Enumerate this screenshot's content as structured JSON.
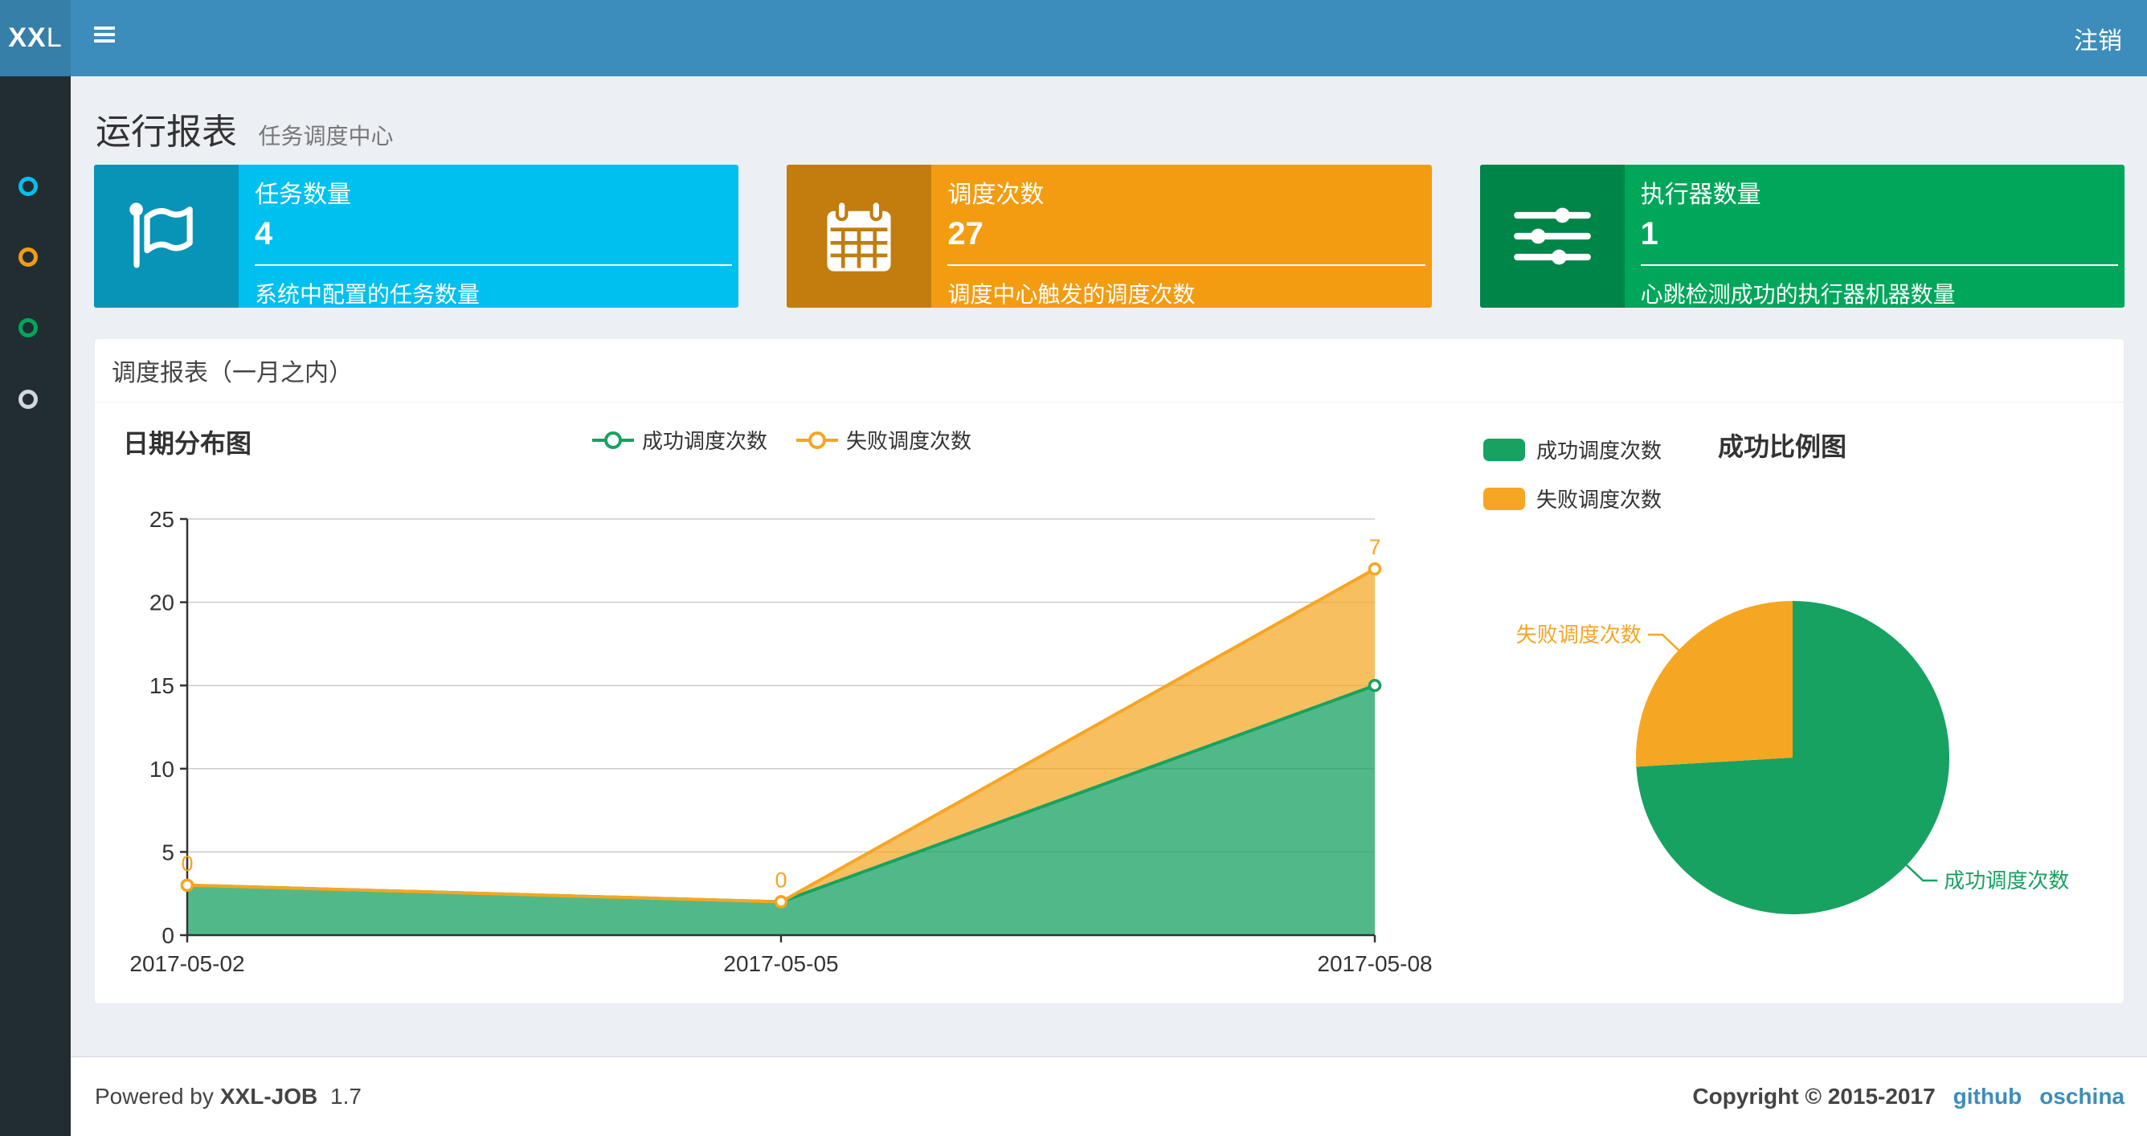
{
  "topbar": {
    "logo_bold": "XX",
    "logo_light": "L",
    "logout_label": "注销",
    "bar_color": "#3c8dbc",
    "logo_bg": "#367fa9"
  },
  "sidebar": {
    "bg": "#222d32",
    "items": [
      {
        "icon": "circle-icon",
        "color": "#00c0ef"
      },
      {
        "icon": "circle-icon",
        "color": "#f39c12"
      },
      {
        "icon": "circle-icon",
        "color": "#00a65a"
      },
      {
        "icon": "circle-icon",
        "color": "#d2d6de"
      }
    ]
  },
  "page": {
    "title": "运行报表",
    "subtitle": "任务调度中心"
  },
  "cards": [
    {
      "label": "任务数量",
      "value": "4",
      "desc": "系统中配置的任务数量",
      "color": "#00c0ef",
      "icon_bg": "#0894b6",
      "icon": "flag-icon"
    },
    {
      "label": "调度次数",
      "value": "27",
      "desc": "调度中心触发的调度次数",
      "color": "#f39c12",
      "icon_bg": "#c27d0e",
      "icon": "calendar-icon"
    },
    {
      "label": "执行器数量",
      "value": "1",
      "desc": "心跳检测成功的执行器机器数量",
      "color": "#00a65a",
      "icon_bg": "#008548",
      "icon": "sliders-icon"
    }
  ],
  "panel": {
    "title": "调度报表（一月之内）"
  },
  "chart_data": [
    {
      "type": "area",
      "title": "日期分布图",
      "x": [
        "2017-05-02",
        "2017-05-05",
        "2017-05-08"
      ],
      "series": [
        {
          "name": "成功调度次数",
          "values": [
            3,
            2,
            15
          ],
          "color": "#17a261",
          "area": "rgba(23,162,97,0.75)"
        },
        {
          "name": "失败调度次数",
          "values": [
            0,
            0,
            7
          ],
          "color": "#f5a623",
          "area": "rgba(245,166,35,0.72)"
        }
      ],
      "stacked": true,
      "data_labels_series": "失败调度次数",
      "data_labels": [
        0,
        0,
        7
      ],
      "ylim": [
        0,
        25
      ],
      "yticks": [
        0,
        5,
        10,
        15,
        20,
        25
      ],
      "grid": true,
      "legend_position": "top-center",
      "axis_color": "#333333",
      "grid_color": "#cccccc"
    },
    {
      "type": "pie",
      "title": "成功比例图",
      "slices": [
        {
          "label": "成功调度次数",
          "value": 20,
          "color": "#17a261"
        },
        {
          "label": "失败调度次数",
          "value": 7,
          "color": "#f5a623"
        }
      ],
      "legend": [
        "成功调度次数",
        "失败调度次数"
      ],
      "legend_position": "top-left",
      "start_angle": "top",
      "direction": "clockwise"
    }
  ],
  "footer": {
    "powered_prefix": "Powered by",
    "product": "XXL-JOB",
    "version": "1.7",
    "copyright": "Copyright © 2015-2017",
    "links": [
      "github",
      "oschina"
    ]
  }
}
